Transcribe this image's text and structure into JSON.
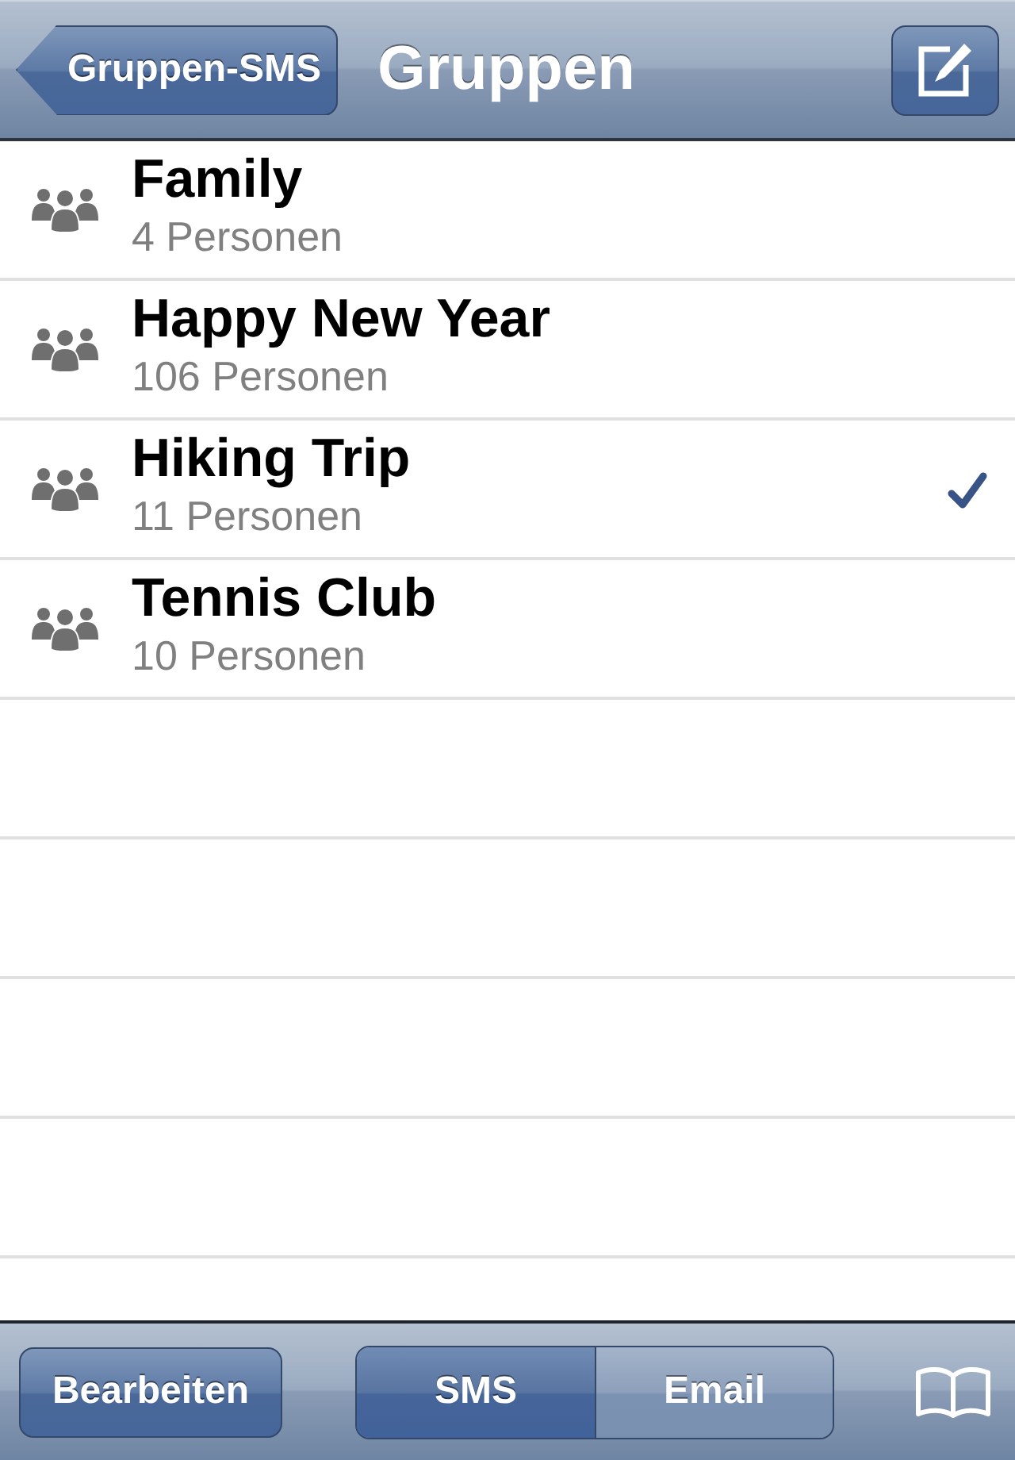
{
  "nav_bar": {
    "back_button": "Gruppen-SMS",
    "title": "Gruppen"
  },
  "groups": [
    {
      "name": "Family",
      "count": "4 Personen",
      "selected": false
    },
    {
      "name": "Happy New Year",
      "count": "106 Personen",
      "selected": false
    },
    {
      "name": "Hiking Trip",
      "count": "11 Personen",
      "selected": true
    },
    {
      "name": "Tennis Club",
      "count": "10 Personen",
      "selected": false
    }
  ],
  "toolbar": {
    "edit_button": "Bearbeiten",
    "segments": [
      {
        "label": "SMS",
        "selected": true
      },
      {
        "label": "Email",
        "selected": false
      }
    ]
  }
}
